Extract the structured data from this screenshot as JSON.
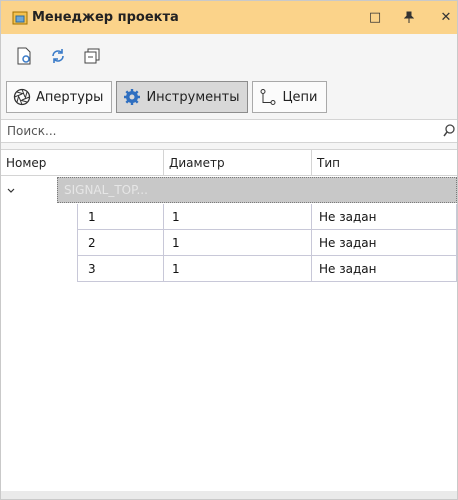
{
  "window": {
    "title": "Менеджер проекта",
    "maximize_glyph": "□",
    "pin_glyph": "╬",
    "close_glyph": "✕"
  },
  "toolbar": {
    "icons": [
      "document-settings-icon",
      "refresh-icon",
      "collapse-icon"
    ]
  },
  "tabs": [
    {
      "label": "Апертуры",
      "icon": "aperture-icon",
      "active": false
    },
    {
      "label": "Инструменты",
      "icon": "gear-icon",
      "active": true
    },
    {
      "label": "Цепи",
      "icon": "chain-icon",
      "active": false
    }
  ],
  "search": {
    "placeholder": "Поиск..."
  },
  "grid": {
    "columns": [
      "Номер",
      "Диаметр",
      "Тип"
    ],
    "group": {
      "label": "SIGNAL_TOP..."
    },
    "rows": [
      {
        "number": "1",
        "diameter": "1",
        "type": "Не задан"
      },
      {
        "number": "2",
        "diameter": "1",
        "type": "Не задан"
      },
      {
        "number": "3",
        "diameter": "1",
        "type": "Не задан"
      }
    ]
  },
  "colors": {
    "titlebar": "#fbd38a",
    "active_tab": "#d8d8d8",
    "group_row": "#c8c8c8"
  }
}
